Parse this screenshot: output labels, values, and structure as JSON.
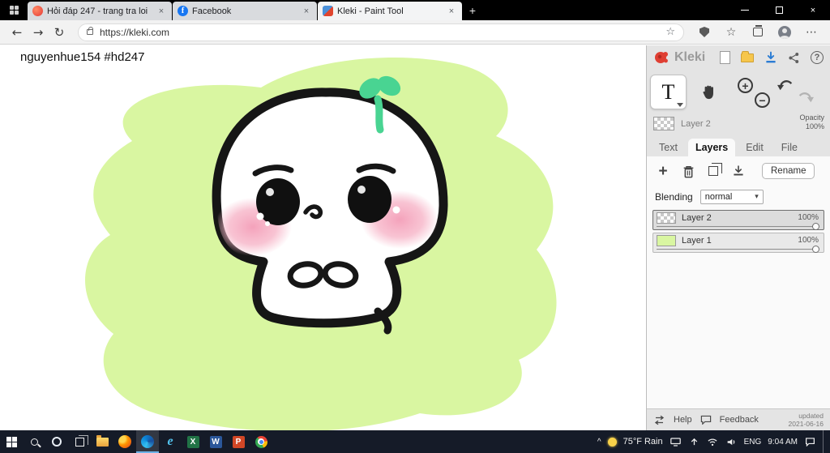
{
  "titlebar": {
    "tabs": [
      {
        "title": "Hỏi đáp 247 - trang tra loi"
      },
      {
        "title": "Facebook",
        "favicon_letter": "f"
      },
      {
        "title": "Kleki - Paint Tool"
      }
    ],
    "new_tab_glyph": "+",
    "close_glyph": "×"
  },
  "toolbar": {
    "back_glyph": "←",
    "forward_glyph": "→",
    "reload_glyph": "↻",
    "url": "https://kleki.com",
    "favorite_glyph": "☆",
    "menu_glyph": "⋯"
  },
  "canvas": {
    "watermark": "nguyenhue154 #hd247"
  },
  "sidebar": {
    "logo_text": "Kleki",
    "help_glyph": "?",
    "text_tool_glyph": "T",
    "active_layer_name": "Layer 2",
    "opacity_label": "Opacity",
    "opacity_value": "100%",
    "tabs": [
      {
        "label": "Text"
      },
      {
        "label": "Layers"
      },
      {
        "label": "Edit"
      },
      {
        "label": "File"
      }
    ],
    "rename_label": "Rename",
    "blending_label": "Blending",
    "blending_value": "normal",
    "blending_caret": "▾",
    "layers": [
      {
        "name": "Layer 2",
        "opacity": "100%"
      },
      {
        "name": "Layer 1",
        "opacity": "100%"
      }
    ],
    "footer": {
      "help": "Help",
      "feedback": "Feedback",
      "updated_line1": "updated",
      "updated_line2": "2021-06-16"
    }
  },
  "taskbar": {
    "tray_caret": "^",
    "weather": "75°F Rain",
    "language": "ENG",
    "time": "9:04 AM",
    "app_letters": {
      "ie": "e",
      "excel": "X",
      "word": "W",
      "powerpoint": "P"
    }
  },
  "colors": {
    "canvas_green": "#d9f6a1",
    "sprout_green": "#49d492",
    "blush_pink": "#f6aec3",
    "outline_black": "#161616",
    "accent_blue": "#2b7cd3"
  }
}
